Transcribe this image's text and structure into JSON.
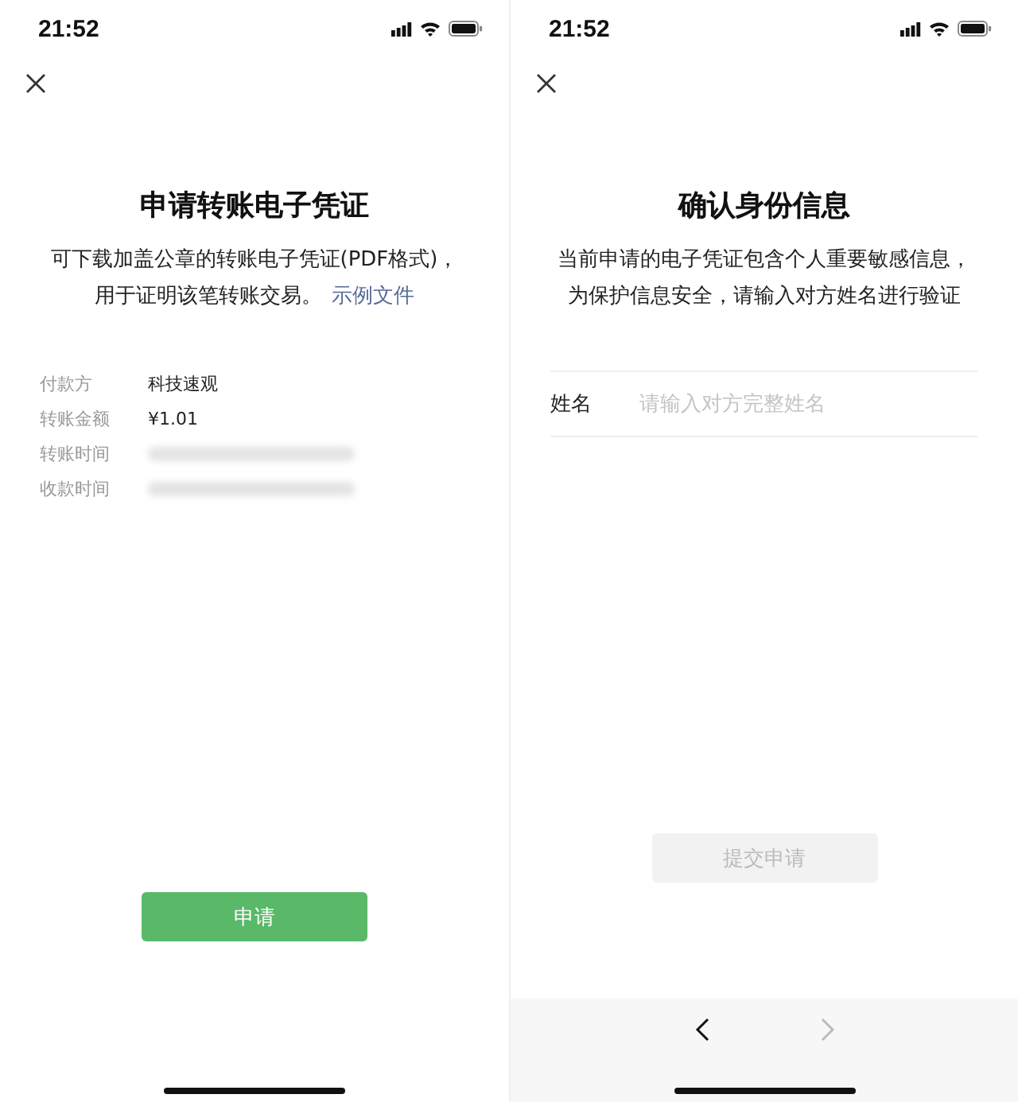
{
  "screens": [
    {
      "status_bar": {
        "time": "21:52"
      },
      "title": "申请转账电子凭证",
      "description": {
        "lines": [
          "可下载加盖公章的转账电子凭证(PDF格式)，",
          "用于证明该笔转账交易。"
        ],
        "link": "示例文件"
      },
      "details": [
        {
          "label": "付款方",
          "kind": "text",
          "value": "科技速观"
        },
        {
          "label": "转账金额",
          "kind": "text",
          "value": "¥1.01"
        },
        {
          "label": "转账时间",
          "kind": "blurred"
        },
        {
          "label": "收款时间",
          "kind": "blurred"
        }
      ],
      "button": {
        "label": "申请",
        "disabled": false
      }
    },
    {
      "status_bar": {
        "time": "21:52"
      },
      "title": "确认身份信息",
      "description": {
        "lines": [
          "当前申请的电子凭证包含个人重要敏感信息，",
          "为保护信息安全，请输入对方姓名进行验证"
        ]
      },
      "field": {
        "label": "姓名",
        "placeholder": "请输入对方完整姓名"
      },
      "button": {
        "label": "提交申请",
        "disabled": true
      },
      "nav": {
        "back_disabled": false,
        "forward_disabled": true
      }
    }
  ]
}
